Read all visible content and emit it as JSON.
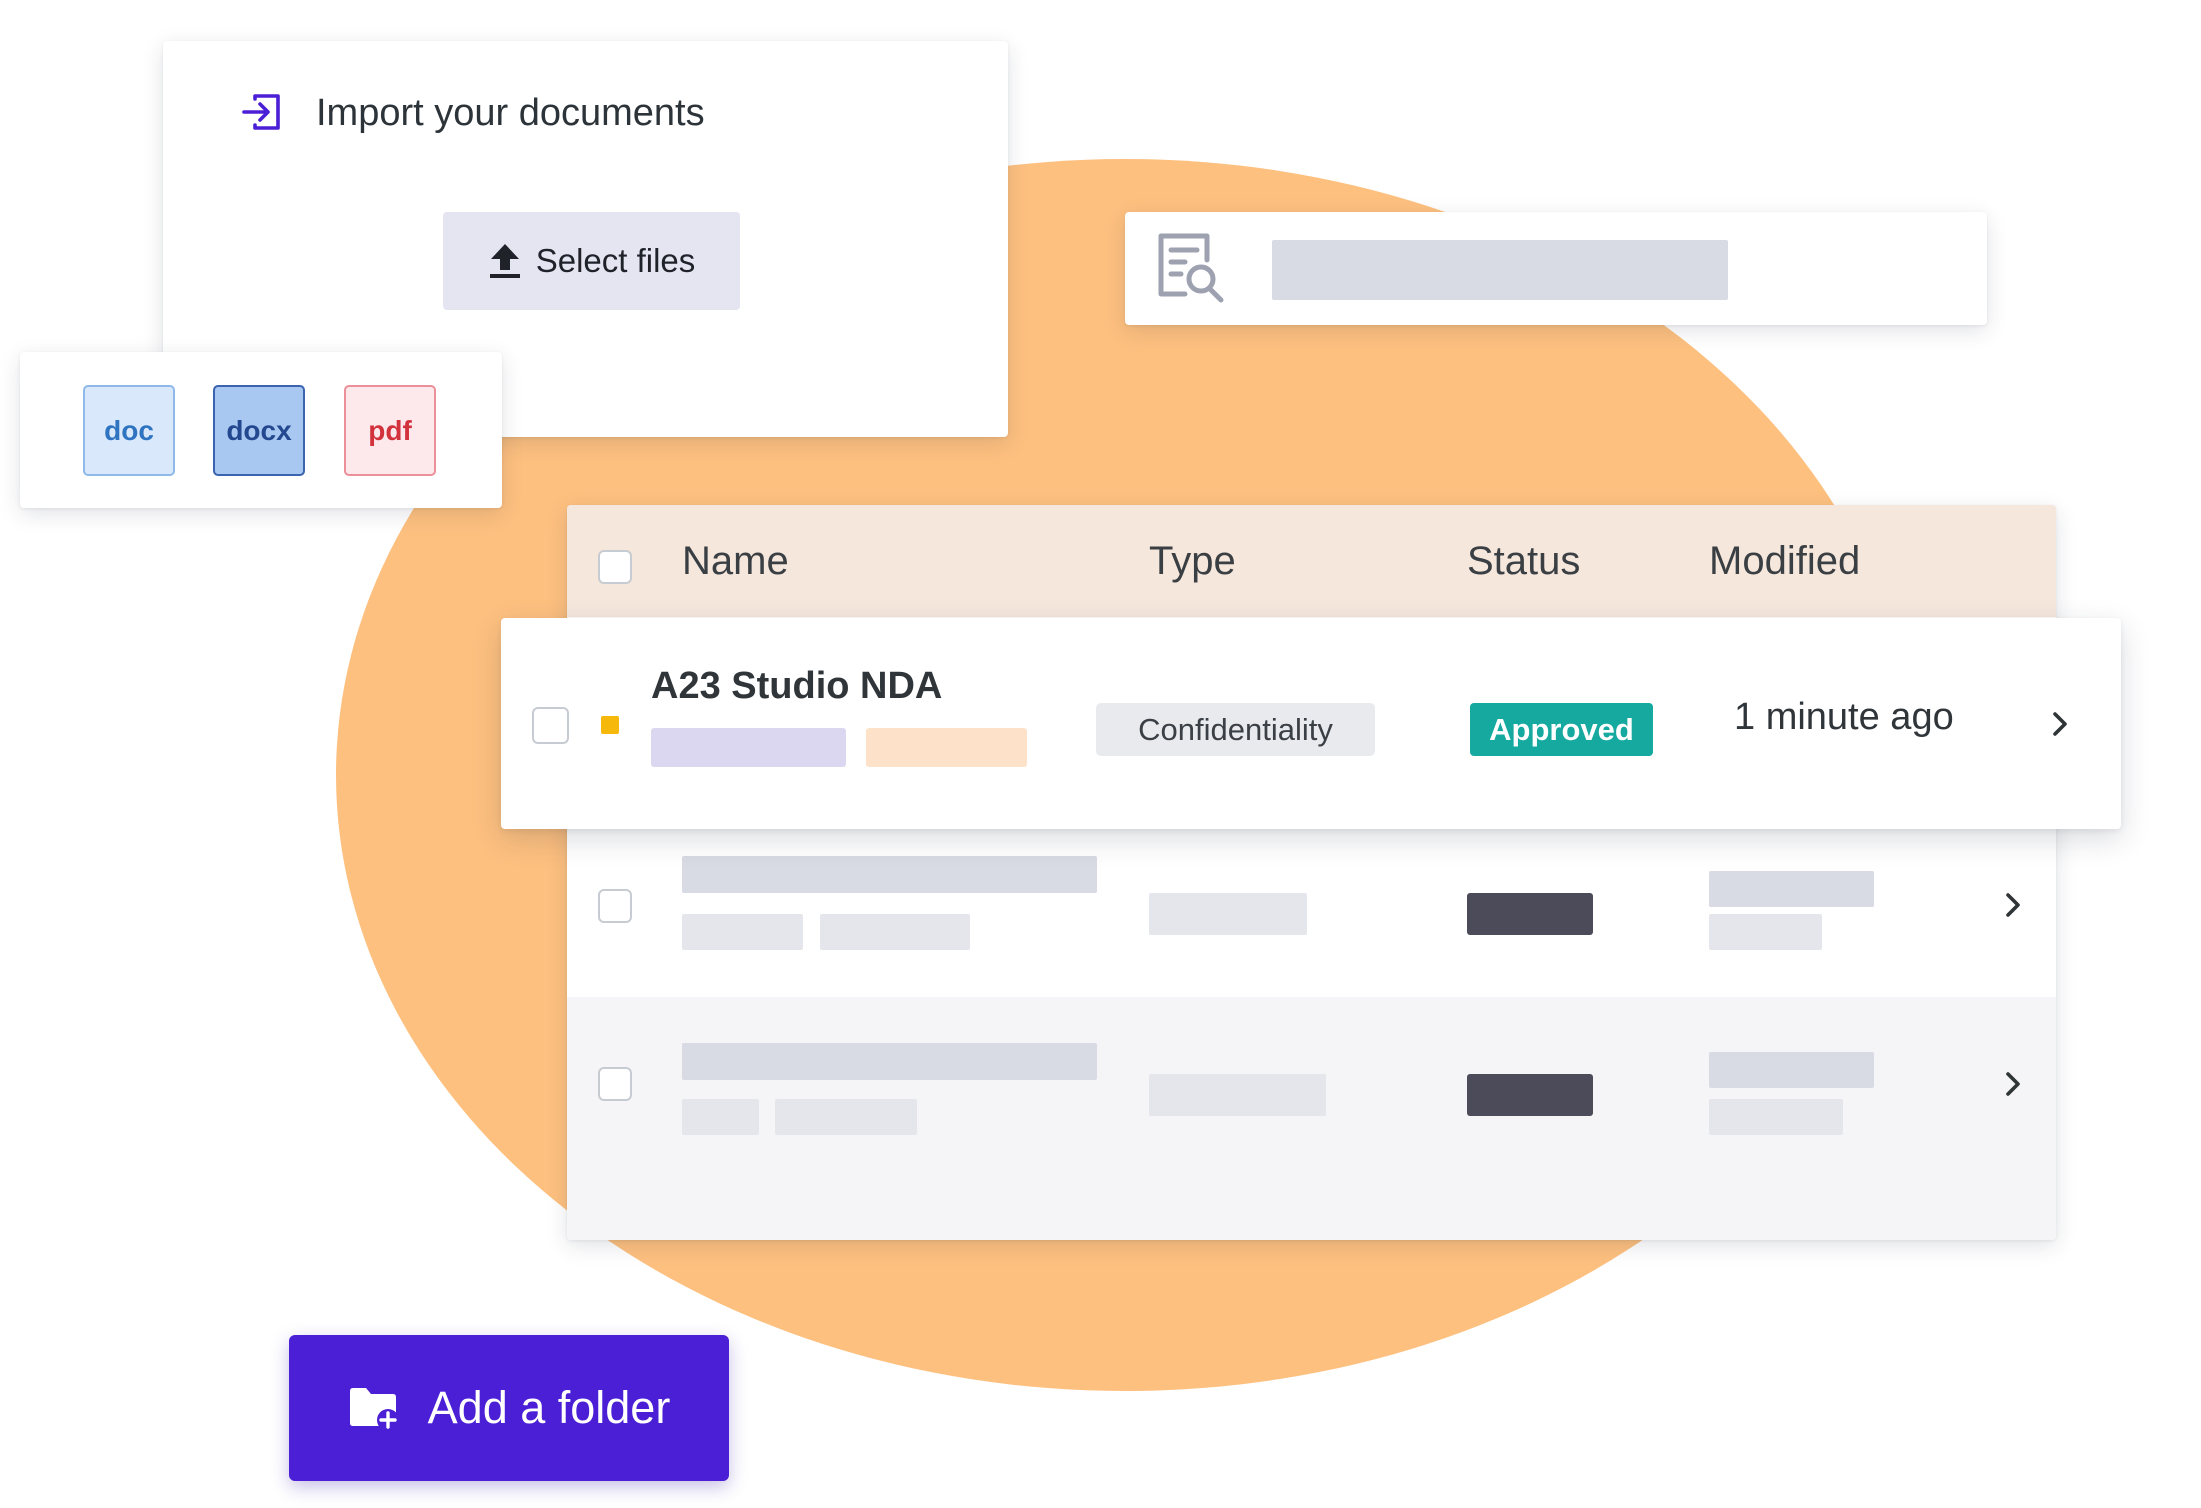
{
  "import_card": {
    "icon": "import-icon",
    "title": "Import your documents",
    "select_files_label": "Select files",
    "select_files_icon": "upload-icon"
  },
  "file_types": [
    "doc",
    "docx",
    "pdf"
  ],
  "search": {
    "icon": "document-search-icon"
  },
  "table": {
    "columns": [
      "Name",
      "Type",
      "Status",
      "Modified"
    ],
    "highlighted_row": {
      "name": "A23 Studio NDA",
      "type": "Confidentiality",
      "status": "Approved",
      "modified": "1 minute ago"
    }
  },
  "add_folder": {
    "label": "Add a folder",
    "icon": "add-folder-icon"
  },
  "colors": {
    "blob": "#fdc07f",
    "primary": "#4b1fd6",
    "status_approved": "#16a9a0",
    "flag_yellow": "#f6b80b"
  }
}
